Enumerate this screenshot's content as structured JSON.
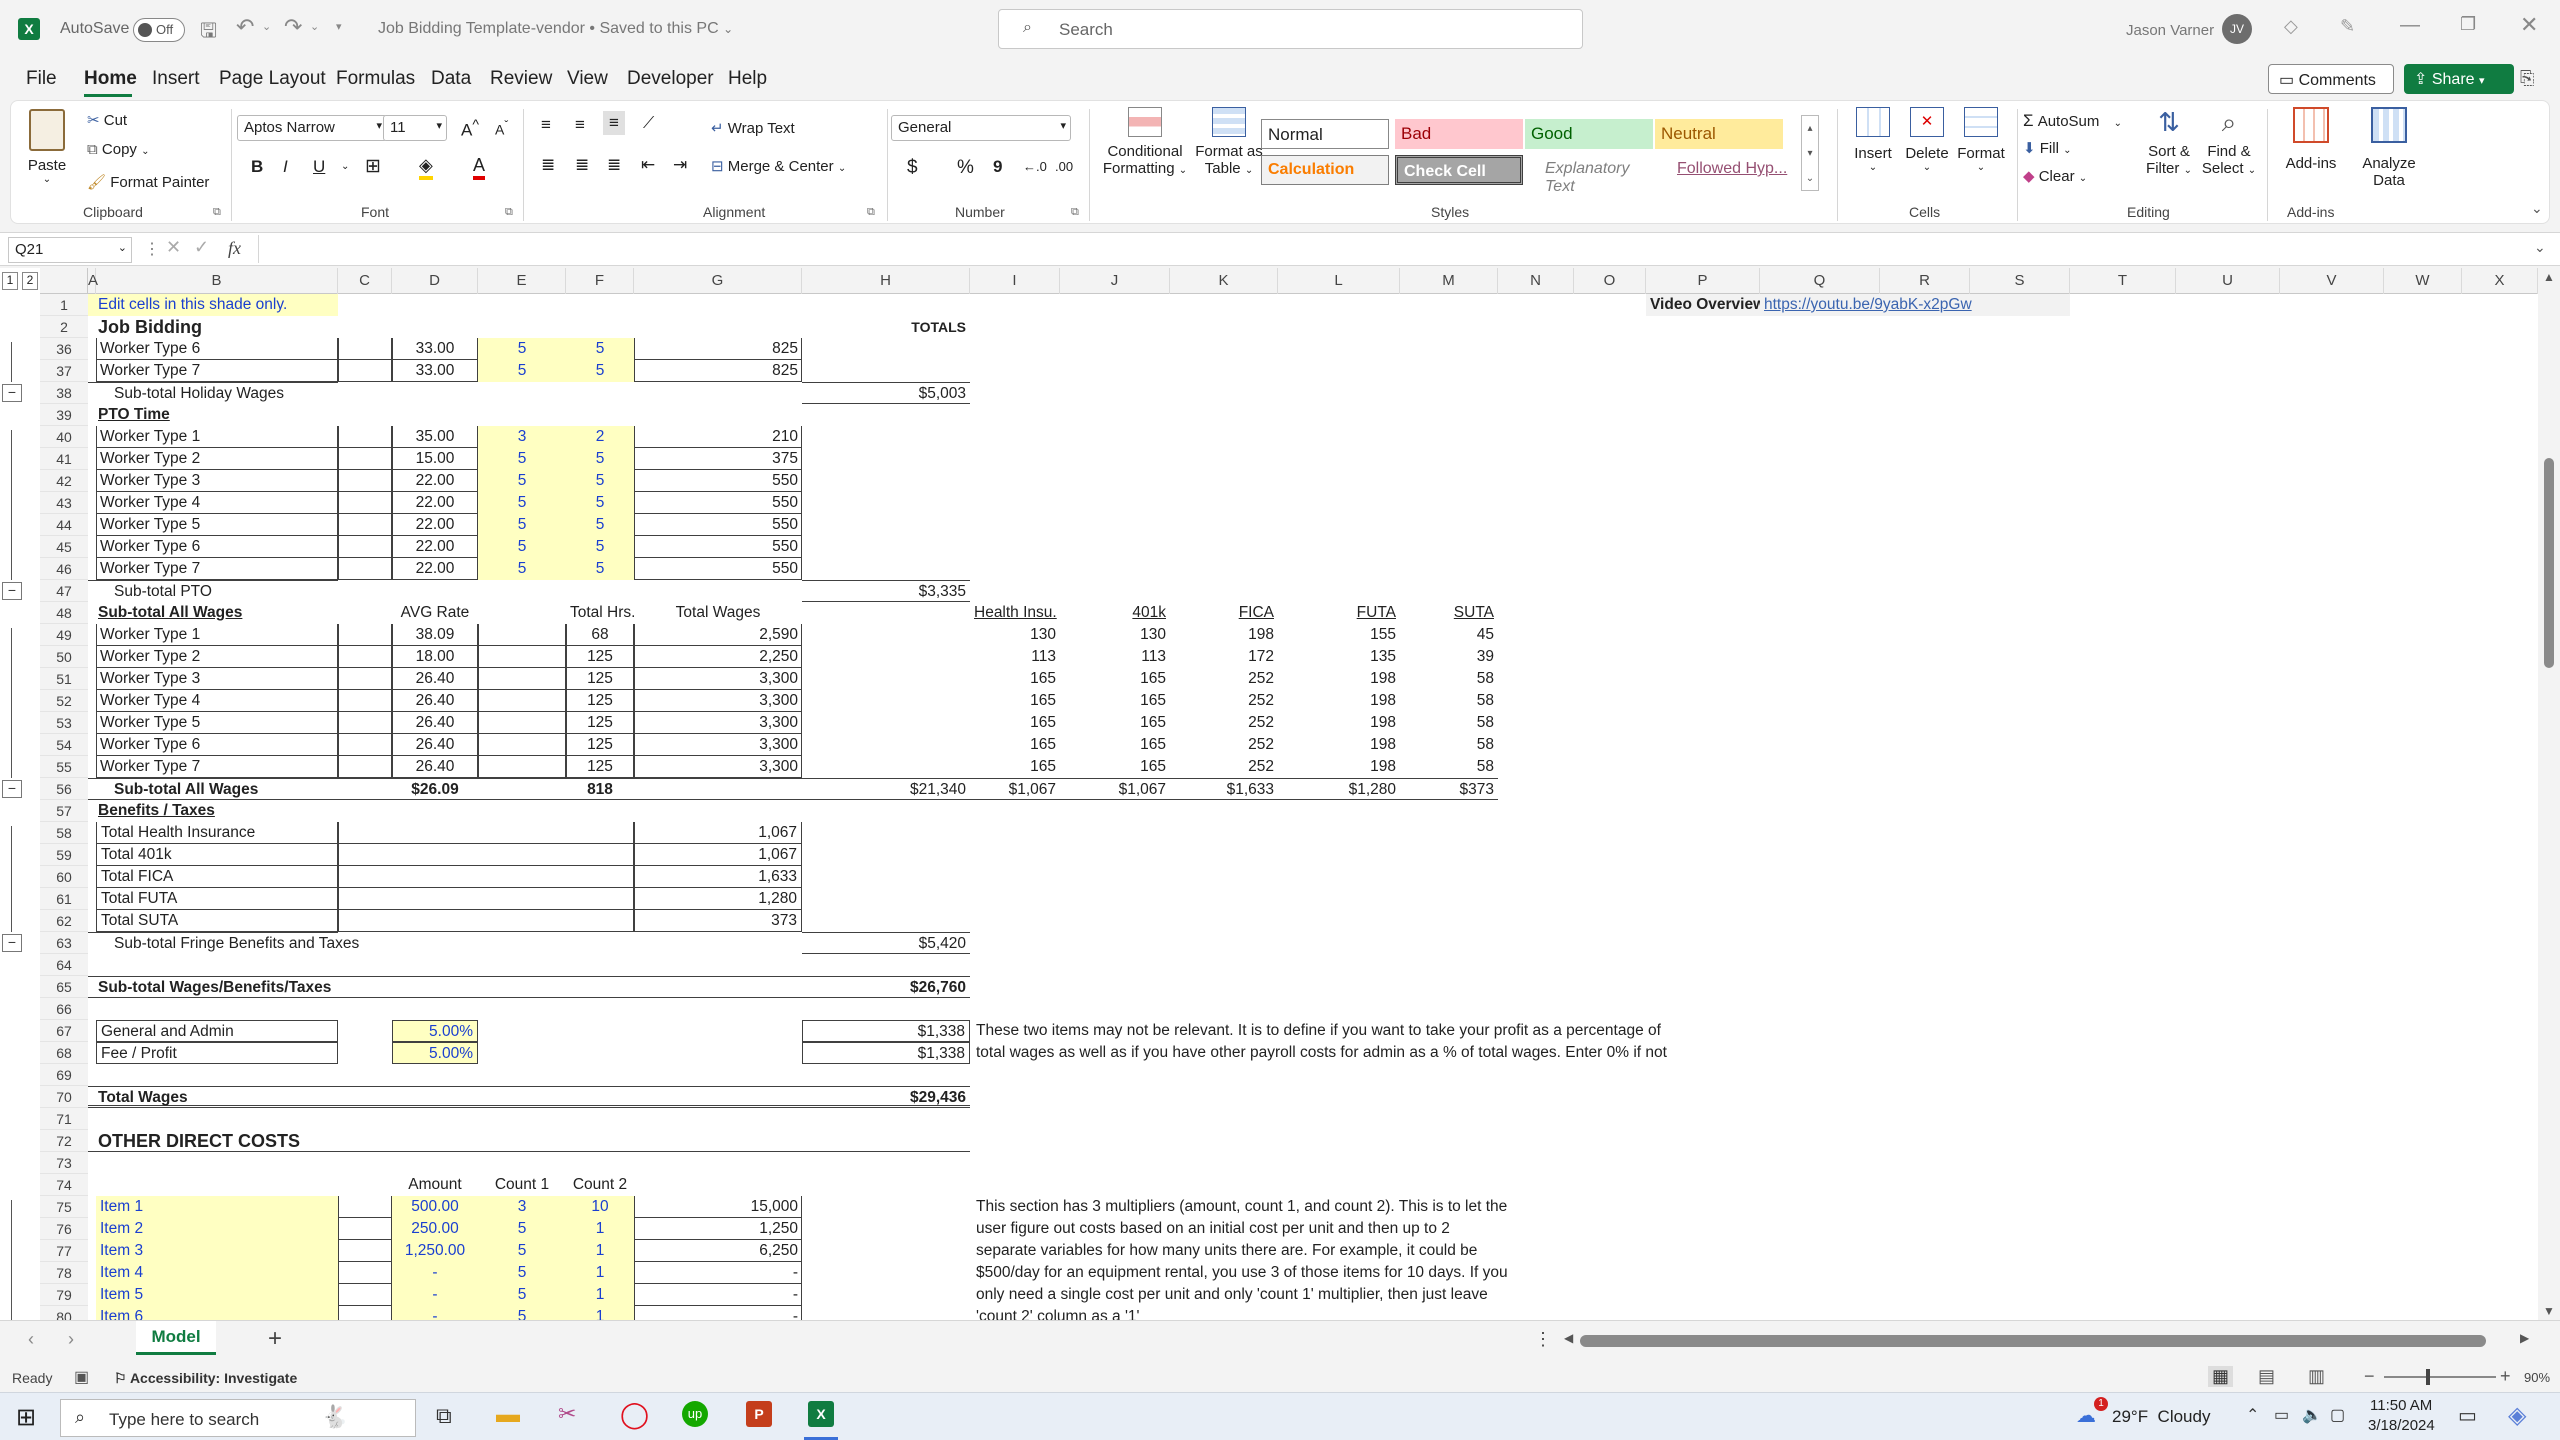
{
  "titlebar": {
    "autosave_label": "AutoSave",
    "autosave_state": "Off",
    "doc_title": "Job Bidding Template-vendor",
    "saved_status": "Saved to this PC",
    "search_placeholder": "Search",
    "user_name": "Jason Varner",
    "user_initials": "JV"
  },
  "ribbon_tabs": [
    "File",
    "Home",
    "Insert",
    "Page Layout",
    "Formulas",
    "Data",
    "Review",
    "View",
    "Developer",
    "Help"
  ],
  "ribbon_buttons": {
    "comments": "Comments",
    "share": "Share"
  },
  "clipboard": {
    "paste": "Paste",
    "cut": "Cut",
    "copy": "Copy",
    "format_painter": "Format Painter",
    "group": "Clipboard"
  },
  "font": {
    "name": "Aptos Narrow",
    "size": "11",
    "group": "Font",
    "bold": "B",
    "italic": "I",
    "underline": "U"
  },
  "alignment": {
    "wrap": "Wrap Text",
    "merge": "Merge & Center",
    "group": "Alignment"
  },
  "number": {
    "format": "General",
    "group": "Number",
    "currency": "$",
    "percent": "%",
    "comma": "9"
  },
  "styles": {
    "conditional": "Conditional\nFormatting",
    "conditional_l1": "Conditional",
    "conditional_l2": "Formatting",
    "table_l1": "Format as",
    "table_l2": "Table",
    "normal": "Normal",
    "bad": "Bad",
    "good": "Good",
    "neutral": "Neutral",
    "calculation": "Calculation",
    "check": "Check Cell",
    "explanatory": "Explanatory Text",
    "followed": "Followed Hyp...",
    "group": "Styles"
  },
  "cells": {
    "insert": "Insert",
    "delete": "Delete",
    "format": "Format",
    "group": "Cells"
  },
  "editing": {
    "autosum": "AutoSum",
    "fill": "Fill",
    "clear": "Clear",
    "sort_l1": "Sort &",
    "sort_l2": "Filter",
    "find_l1": "Find &",
    "find_l2": "Select",
    "group": "Editing"
  },
  "addins": {
    "addins": "Add-ins",
    "analyze_l1": "Analyze",
    "analyze_l2": "Data",
    "group": "Add-ins"
  },
  "formula_bar": {
    "namebox": "Q21",
    "fx": "fx",
    "formula": ""
  },
  "columns": [
    "A",
    "B",
    "C",
    "D",
    "E",
    "F",
    "G",
    "H",
    "I",
    "J",
    "K",
    "L",
    "M",
    "N",
    "O",
    "P",
    "Q",
    "R",
    "S",
    "T",
    "U",
    "V",
    "W",
    "X"
  ],
  "sheet": {
    "r1_note": "Edit cells in this shade only.",
    "r1_video_label": "Video Overview:",
    "r1_video_link": "https://youtu.be/9yabK-x2pGw",
    "r2_title": "Job Bidding",
    "r2_totals": "TOTALS",
    "r36": {
      "name": "Worker Type 6",
      "d": "33.00",
      "e": "5",
      "f": "5",
      "g": "825"
    },
    "r37": {
      "name": "Worker Type 7",
      "d": "33.00",
      "e": "5",
      "f": "5",
      "g": "825"
    },
    "r38": {
      "label": "Sub-total Holiday Wages",
      "h": "$5,003"
    },
    "r39": "PTO Time",
    "pto_rows": [
      {
        "n": "40",
        "name": "Worker Type 1",
        "d": "35.00",
        "e": "3",
        "f": "2",
        "g": "210"
      },
      {
        "n": "41",
        "name": "Worker Type 2",
        "d": "15.00",
        "e": "5",
        "f": "5",
        "g": "375"
      },
      {
        "n": "42",
        "name": "Worker Type 3",
        "d": "22.00",
        "e": "5",
        "f": "5",
        "g": "550"
      },
      {
        "n": "43",
        "name": "Worker Type 4",
        "d": "22.00",
        "e": "5",
        "f": "5",
        "g": "550"
      },
      {
        "n": "44",
        "name": "Worker Type 5",
        "d": "22.00",
        "e": "5",
        "f": "5",
        "g": "550"
      },
      {
        "n": "45",
        "name": "Worker Type 6",
        "d": "22.00",
        "e": "5",
        "f": "5",
        "g": "550"
      },
      {
        "n": "46",
        "name": "Worker Type 7",
        "d": "22.00",
        "e": "5",
        "f": "5",
        "g": "550"
      }
    ],
    "r47": {
      "label": "Sub-total PTO",
      "h": "$3,335"
    },
    "r48": {
      "label": "Sub-total All Wages",
      "d": "AVG Rate",
      "f": "Total Hrs.",
      "g": "Total Wages",
      "i": "Health Insu.",
      "j": "401k",
      "k": "FICA",
      "l": "FUTA",
      "m": "SUTA"
    },
    "all_rows": [
      {
        "n": "49",
        "name": "Worker Type 1",
        "d": "38.09",
        "f": "68",
        "g": "2,590",
        "i": "130",
        "j": "130",
        "k": "198",
        "l": "155",
        "m": "45"
      },
      {
        "n": "50",
        "name": "Worker Type 2",
        "d": "18.00",
        "f": "125",
        "g": "2,250",
        "i": "113",
        "j": "113",
        "k": "172",
        "l": "135",
        "m": "39"
      },
      {
        "n": "51",
        "name": "Worker Type 3",
        "d": "26.40",
        "f": "125",
        "g": "3,300",
        "i": "165",
        "j": "165",
        "k": "252",
        "l": "198",
        "m": "58"
      },
      {
        "n": "52",
        "name": "Worker Type 4",
        "d": "26.40",
        "f": "125",
        "g": "3,300",
        "i": "165",
        "j": "165",
        "k": "252",
        "l": "198",
        "m": "58"
      },
      {
        "n": "53",
        "name": "Worker Type 5",
        "d": "26.40",
        "f": "125",
        "g": "3,300",
        "i": "165",
        "j": "165",
        "k": "252",
        "l": "198",
        "m": "58"
      },
      {
        "n": "54",
        "name": "Worker Type 6",
        "d": "26.40",
        "f": "125",
        "g": "3,300",
        "i": "165",
        "j": "165",
        "k": "252",
        "l": "198",
        "m": "58"
      },
      {
        "n": "55",
        "name": "Worker Type 7",
        "d": "26.40",
        "f": "125",
        "g": "3,300",
        "i": "165",
        "j": "165",
        "k": "252",
        "l": "198",
        "m": "58"
      }
    ],
    "r56": {
      "label": "Sub-total All Wages",
      "d": "$26.09",
      "f": "818",
      "h": "$21,340",
      "i": "$1,067",
      "j": "$1,067",
      "k": "$1,633",
      "l": "$1,280",
      "m": "$373"
    },
    "r57": "Benefits / Taxes",
    "ben_rows": [
      {
        "n": "58",
        "name": "Total Health Insurance",
        "g": "1,067"
      },
      {
        "n": "59",
        "name": "Total 401k",
        "g": "1,067"
      },
      {
        "n": "60",
        "name": "Total FICA",
        "g": "1,633"
      },
      {
        "n": "61",
        "name": "Total FUTA",
        "g": "1,280"
      },
      {
        "n": "62",
        "name": "Total SUTA",
        "g": "373"
      }
    ],
    "r63": {
      "label": "Sub-total Fringe Benefits and Taxes",
      "h": "$5,420"
    },
    "r65": {
      "label": "Sub-total Wages/Benefits/Taxes",
      "h": "$26,760"
    },
    "r67": {
      "label": "General and Admin",
      "d": "5.00%",
      "h": "$1,338",
      "note": "These two items may not be relevant. It is to define if you want to take your profit as a percentage of"
    },
    "r68": {
      "label": "Fee / Profit",
      "d": "5.00%",
      "h": "$1,338",
      "note": "total wages as well as if you have other payroll costs for admin as a % of total wages. Enter 0% if not"
    },
    "r70": {
      "label": "Total Wages",
      "h": "$29,436"
    },
    "r72": "OTHER DIRECT COSTS",
    "r74": {
      "d": "Amount",
      "e": "Count 1",
      "f": "Count 2"
    },
    "item_rows": [
      {
        "n": "75",
        "name": "Item 1",
        "d": "500.00",
        "e": "3",
        "f": "10",
        "g": "15,000",
        "note": "This section has 3 multipliers (amount, count 1, and count 2). This is to let the"
      },
      {
        "n": "76",
        "name": "Item 2",
        "d": "250.00",
        "e": "5",
        "f": "1",
        "g": "1,250",
        "note": "user figure out costs based on an initial cost per unit and then up to 2"
      },
      {
        "n": "77",
        "name": "Item 3",
        "d": "1,250.00",
        "e": "5",
        "f": "1",
        "g": "6,250",
        "note": "separate variables for how many units there are. For example, it could be"
      },
      {
        "n": "78",
        "name": "Item 4",
        "d": "-",
        "e": "5",
        "f": "1",
        "g": "-",
        "note": "$500/day for an equipment rental, you use 3 of those items for 10 days. If you"
      },
      {
        "n": "79",
        "name": "Item 5",
        "d": "-",
        "e": "5",
        "f": "1",
        "g": "-",
        "note": "only need a single cost per unit and only 'count 1' multiplier, then just leave"
      },
      {
        "n": "80",
        "name": "Item 6",
        "d": "-",
        "e": "5",
        "f": "1",
        "g": "-",
        "note": "'count 2' column as a '1'"
      }
    ]
  },
  "sheet_tabs": {
    "active": "Model",
    "add": "+"
  },
  "status": {
    "ready": "Ready",
    "accessibility": "Accessibility: Investigate",
    "zoom": "90%"
  },
  "taskbar": {
    "search": "Type here to search",
    "weather": "29°F  Cloudy",
    "time": "11:50 AM",
    "date": "3/18/2024",
    "badge": "1"
  }
}
